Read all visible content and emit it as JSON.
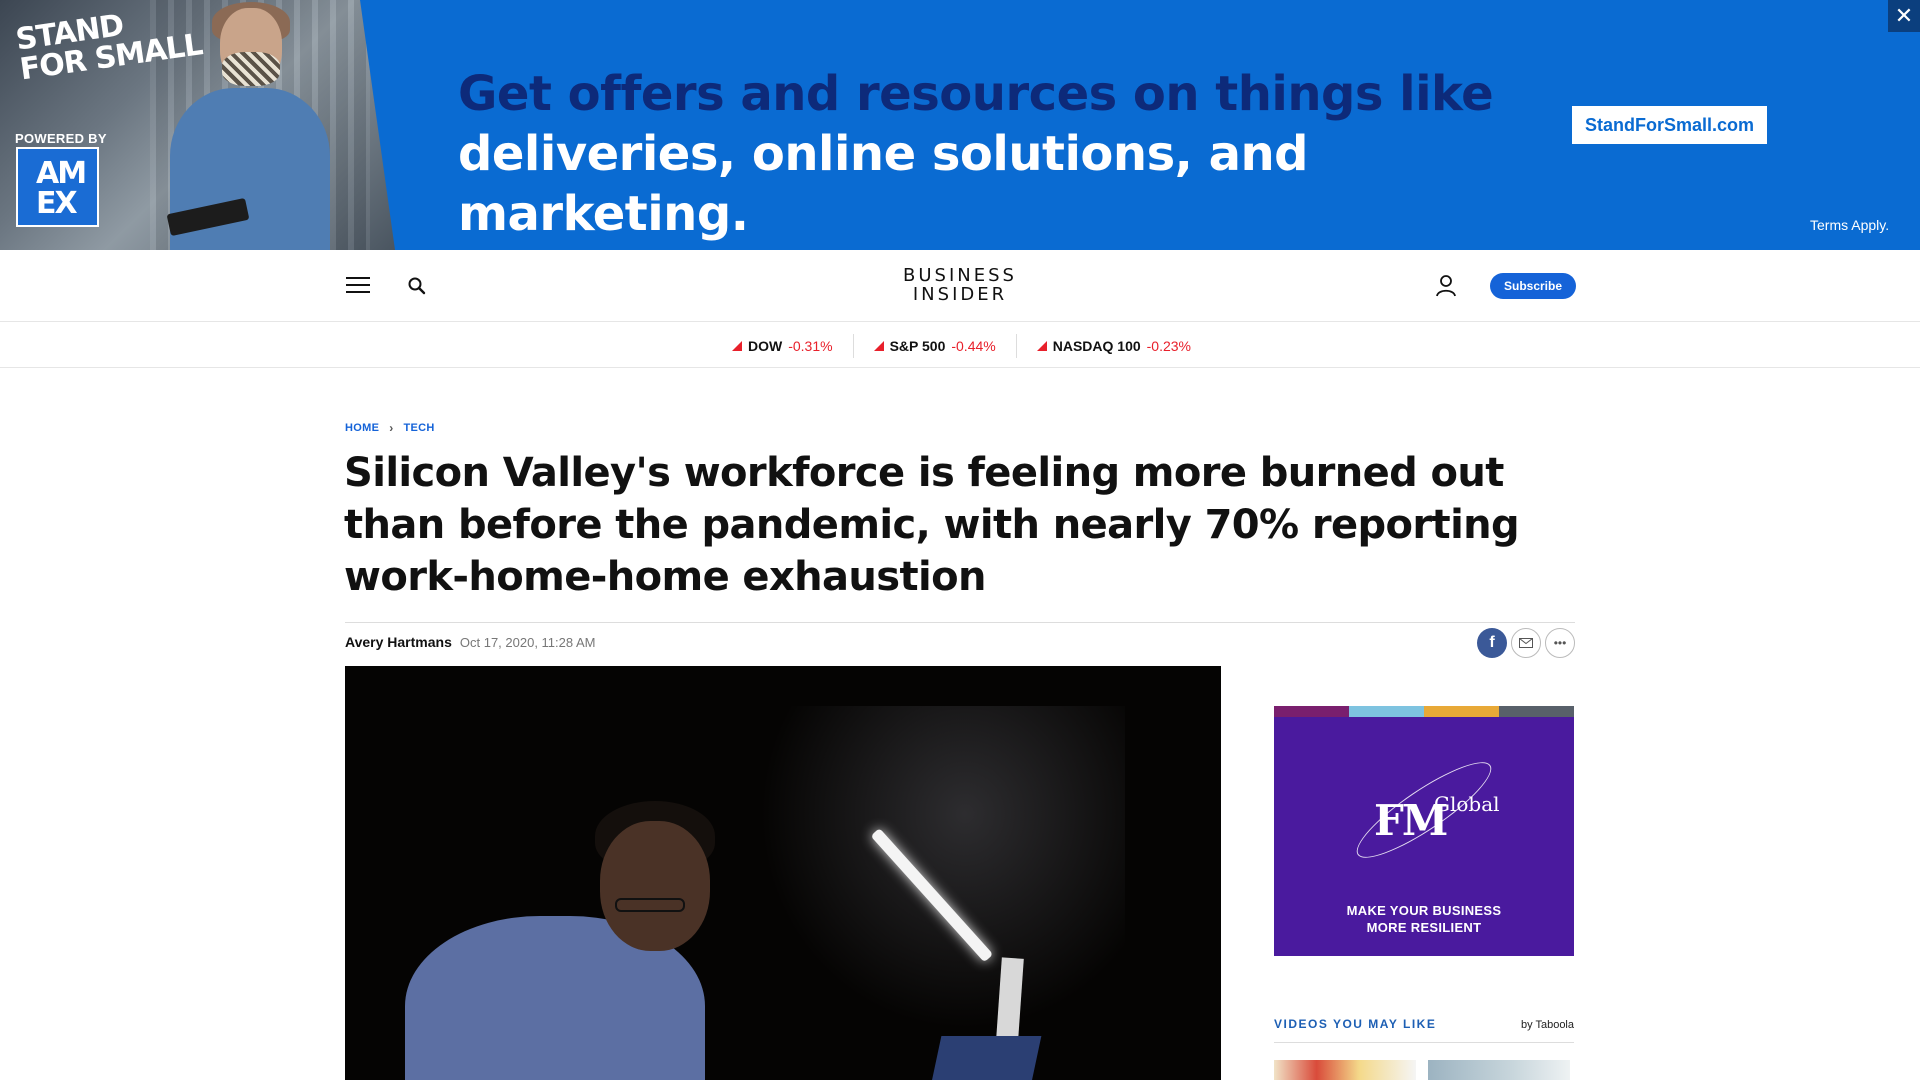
{
  "ad": {
    "logo_line1": "STAND",
    "logo_line2": "FOR SMALL",
    "powered_by": "POWERED BY",
    "amex_line1": "AM",
    "amex_line2": "EX",
    "headline_line1": "Get offers and resources on things like",
    "headline_line2": "deliveries, online solutions, and marketing.",
    "cta": "StandForSmall.com",
    "terms": "Terms Apply.",
    "close_glyph": "✕",
    "colors": {
      "background": "#0a6bd2",
      "headline_dark": "#0d2a7a"
    }
  },
  "nav": {
    "brand_line1": "BUSINESS",
    "brand_line2": "INSIDER",
    "subscribe": "Subscribe",
    "icons": [
      "hamburger-menu-icon",
      "search-icon",
      "user-icon"
    ]
  },
  "ticker": [
    {
      "name": "DOW",
      "change": "-0.31%"
    },
    {
      "name": "S&P 500",
      "change": "-0.44%"
    },
    {
      "name": "NASDAQ 100",
      "change": "-0.23%"
    }
  ],
  "article": {
    "breadcrumb": [
      "HOME",
      "TECH"
    ],
    "headline": "Silicon Valley's workforce is feeling more burned out than before the pandemic, with nearly 70% reporting work-home-home exhaustion",
    "author": "Avery Hartmans",
    "date": "Oct 17, 2020, 11:28 AM",
    "share_icons": [
      "facebook-icon",
      "email-icon",
      "more-icon"
    ]
  },
  "sidebar": {
    "ad_brand_main": "FM",
    "ad_brand_sub": "Global",
    "ad_tagline_line1": "MAKE YOUR BUSINESS",
    "ad_tagline_line2": "MORE RESILIENT",
    "ad_stripe_colors": [
      "#7a1f6e",
      "#7ec3e0",
      "#e8a937",
      "#58606a"
    ],
    "videos_title": "VIDEOS YOU MAY LIKE",
    "videos_by": "by Taboola"
  },
  "colors": {
    "accent": "#1563d8",
    "negative": "#e8202b"
  }
}
